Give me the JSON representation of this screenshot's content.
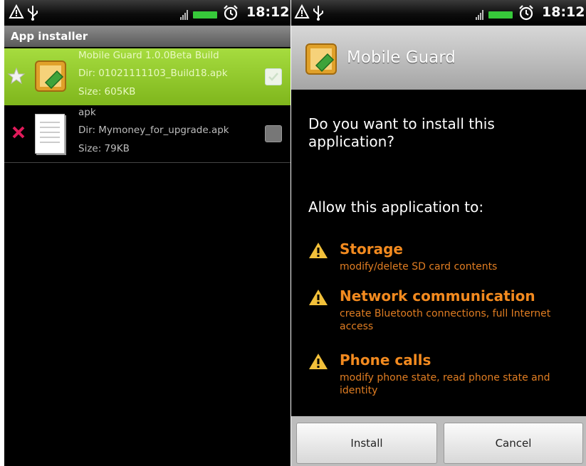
{
  "left_screen": {
    "status_bar": {
      "time": "18:12"
    },
    "title": "App installer",
    "items": [
      {
        "name": "Mobile Guard  1.0.0Beta  Build",
        "dir": "Dir:  01021111103_Build18.apk",
        "size": "Size: 605KB",
        "leading_icon": "star-icon",
        "selected": true
      },
      {
        "name": "apk",
        "dir": "Dir:  Mymoney_for_upgrade.apk",
        "size": "Size: 79KB",
        "leading_icon": "x-mark-icon",
        "selected": false
      }
    ]
  },
  "right_screen": {
    "status_bar": {
      "time": "18:12"
    },
    "app_name": "Mobile Guard",
    "question": "Do you want to install this application?",
    "allow_heading": "Allow this application to:",
    "permissions": [
      {
        "title": "Storage",
        "description": "modify/delete SD card contents"
      },
      {
        "title": "Network communication",
        "description": "create Bluetooth connections, full Internet access"
      },
      {
        "title": "Phone calls",
        "description": "modify phone state, read phone state and identity"
      }
    ],
    "buttons": {
      "install": "Install",
      "cancel": "Cancel"
    }
  },
  "colors": {
    "selected_row": "#94cc2e",
    "permission_title": "#f28a1f",
    "battery": "#37c93a"
  }
}
